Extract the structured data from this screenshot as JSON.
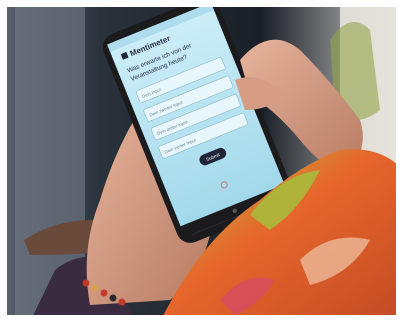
{
  "phone": {
    "app_title": "Mentimeter",
    "question": "Was erwarte ich von der Veranstaltung heute?",
    "fields": [
      "Dein Input",
      "Dein zweiter Input",
      "Dein dritter Input",
      "Dein vierter Input"
    ],
    "submit_label": "Submit"
  },
  "colors": {
    "screen": "#bfe6f3",
    "button": "#1f2436",
    "scarf_orange": "#e65a25",
    "scarf_green": "#9fb640"
  }
}
